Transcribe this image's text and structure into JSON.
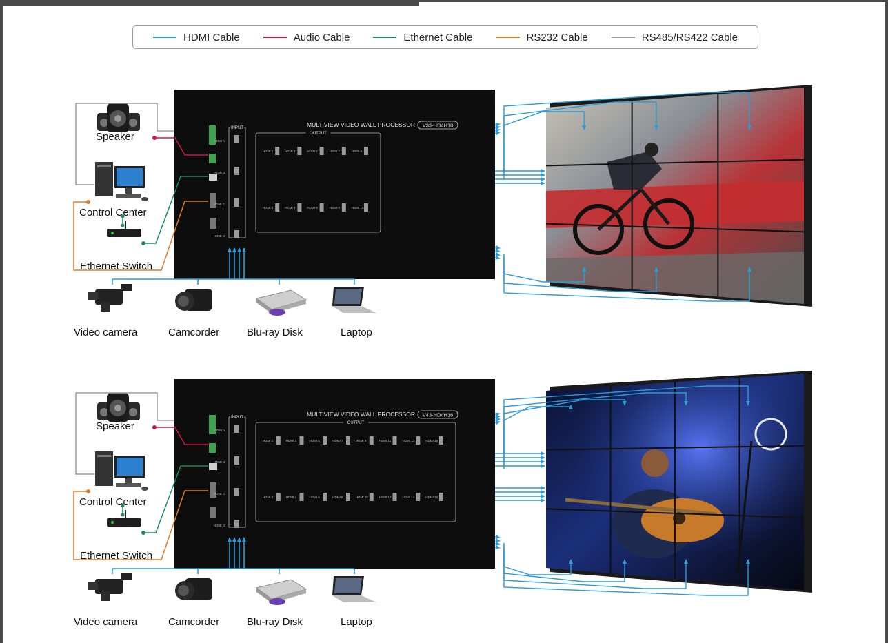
{
  "legend": {
    "items": [
      {
        "label": "HDMI Cable",
        "color": "#2c9bd6"
      },
      {
        "label": "Audio Cable",
        "color": "#c8164a"
      },
      {
        "label": "Ethernet Cable",
        "color": "#1e8a5a"
      },
      {
        "label": "RS232 Cable",
        "color": "#e07b2a"
      },
      {
        "label": "RS485/RS422 Cable",
        "color": "#9a9a9a"
      }
    ]
  },
  "diagrams": [
    {
      "processor": {
        "title": "MULTIVIEW VIDEO WALL PROCESSOR",
        "model": "V33-HD4H10",
        "input_label": "INPUT",
        "output_label": "OUTPUT",
        "inputs": [
          "HDMI A",
          "HDMI B",
          "HDMI C",
          "HDMI D"
        ],
        "outputs_top": [
          "HDMI 1",
          "HDMI 3",
          "HDMI 5",
          "HDMI 7",
          "HDMI 9"
        ],
        "outputs_bottom": [
          "HDMI 2",
          "HDMI 4",
          "HDMI 6",
          "HDMI 8",
          "HDMI 10"
        ]
      },
      "devices": {
        "speaker": "Speaker",
        "control_center": "Control Center",
        "ethernet_switch": "Ethernet Switch",
        "sources": [
          "Video camera",
          "Camcorder",
          "Blu-ray Disk",
          "Laptop"
        ]
      },
      "video_wall": {
        "rows": 3,
        "cols": 3,
        "content": "cyclist"
      }
    },
    {
      "processor": {
        "title": "MULTIVIEW VIDEO WALL PROCESSOR",
        "model": "V43-HD4H16",
        "input_label": "INPUT",
        "output_label": "OUTPUT",
        "inputs": [
          "HDMI A",
          "HDMI B",
          "HDMI C",
          "HDMI D"
        ],
        "outputs_top": [
          "HDMI 1",
          "HDMI 3",
          "HDMI 5",
          "HDMI 7",
          "HDMI 9",
          "HDMI 11",
          "HDMI 13",
          "HDMI 15"
        ],
        "outputs_bottom": [
          "HDMI 2",
          "HDMI 4",
          "HDMI 6",
          "HDMI 8",
          "HDMI 10",
          "HDMI 12",
          "HDMI 14",
          "HDMI 16"
        ]
      },
      "devices": {
        "speaker": "Speaker",
        "control_center": "Control Center",
        "ethernet_switch": "Ethernet Switch",
        "sources": [
          "Video camera",
          "Camcorder",
          "Blu-ray Disk",
          "Laptop"
        ]
      },
      "video_wall": {
        "rows": 3,
        "cols": 4,
        "content": "guitarist"
      }
    }
  ]
}
